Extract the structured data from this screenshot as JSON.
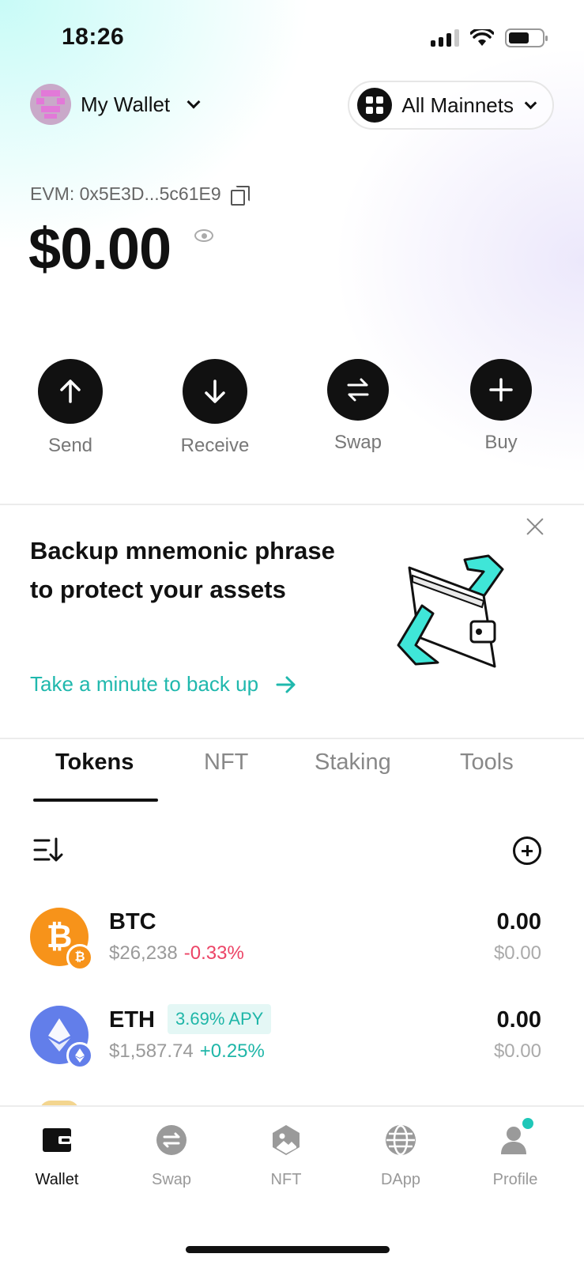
{
  "status_bar": {
    "time": "18:26"
  },
  "header": {
    "wallet_name": "My Wallet",
    "network_label": "All Mainnets"
  },
  "account": {
    "address": "EVM: 0x5E3D...5c61E9",
    "balance": "$0.00"
  },
  "actions": [
    {
      "label": "Send",
      "icon": "arrow-up-icon"
    },
    {
      "label": "Receive",
      "icon": "arrow-down-icon"
    },
    {
      "label": "Swap",
      "icon": "swap-arrows-icon"
    },
    {
      "label": "Buy",
      "icon": "plus-icon"
    }
  ],
  "backup_banner": {
    "title": "Backup mnemonic phrase to protect your assets",
    "link": "Take a minute to back up"
  },
  "tabs": [
    {
      "label": "Tokens",
      "active": true
    },
    {
      "label": "NFT",
      "active": false
    },
    {
      "label": "Staking",
      "active": false
    },
    {
      "label": "Tools",
      "active": false
    }
  ],
  "tokens": [
    {
      "symbol": "BTC",
      "price": "$26,238",
      "change": "-0.33%",
      "amount": "0.00",
      "value": "$0.00",
      "logo_color": "#f7931a",
      "logo_glyph": "₿"
    },
    {
      "symbol": "ETH",
      "badge": "3.69% APY",
      "price": "$1,587.74",
      "change": "+0.25%",
      "amount": "0.00",
      "value": "$0.00",
      "logo_color": "#627eea",
      "logo_glyph": "♦"
    }
  ],
  "bottom_nav": [
    {
      "label": "Wallet",
      "icon": "wallet-icon",
      "active": true
    },
    {
      "label": "Swap",
      "icon": "swap-icon",
      "active": false
    },
    {
      "label": "NFT",
      "icon": "nft-icon",
      "active": false
    },
    {
      "label": "DApp",
      "icon": "globe-icon",
      "active": false
    },
    {
      "label": "Profile",
      "icon": "profile-icon",
      "active": false
    }
  ],
  "colors": {
    "accent": "#20b8ad",
    "negative": "#ec4466",
    "positive": "#1fb6a8"
  }
}
